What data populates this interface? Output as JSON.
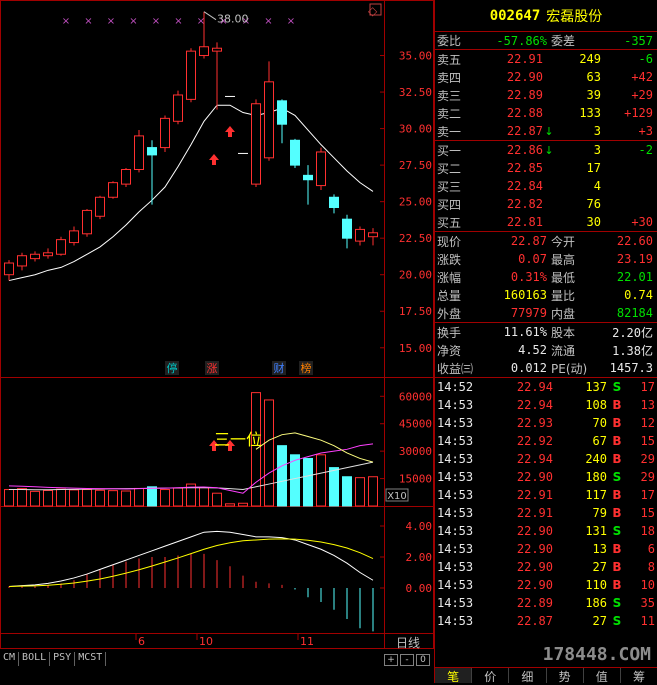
{
  "header": {
    "code": "002647",
    "name": "宏磊股份"
  },
  "ratio": {
    "weibi_label": "委比",
    "weibi_value": "-57.86%",
    "weicha_label": "委差",
    "weicha_value": "-357"
  },
  "asks": [
    {
      "label": "卖五",
      "price": "22.91",
      "vol": "249",
      "chg": "-6",
      "chg_color": "green",
      "arrow": ""
    },
    {
      "label": "卖四",
      "price": "22.90",
      "vol": "63",
      "chg": "+42",
      "chg_color": "red",
      "arrow": ""
    },
    {
      "label": "卖三",
      "price": "22.89",
      "vol": "39",
      "chg": "+29",
      "chg_color": "red",
      "arrow": ""
    },
    {
      "label": "卖二",
      "price": "22.88",
      "vol": "133",
      "chg": "+129",
      "chg_color": "red",
      "arrow": ""
    },
    {
      "label": "卖一",
      "price": "22.87",
      "vol": "3",
      "chg": "+3",
      "chg_color": "red",
      "arrow": "↓"
    }
  ],
  "bids": [
    {
      "label": "买一",
      "price": "22.86",
      "vol": "3",
      "chg": "-2",
      "chg_color": "green",
      "arrow": "↓"
    },
    {
      "label": "买二",
      "price": "22.85",
      "vol": "17",
      "chg": "",
      "chg_color": "red",
      "arrow": ""
    },
    {
      "label": "买三",
      "price": "22.84",
      "vol": "4",
      "chg": "",
      "chg_color": "red",
      "arrow": ""
    },
    {
      "label": "买四",
      "price": "22.82",
      "vol": "76",
      "chg": "",
      "chg_color": "red",
      "arrow": ""
    },
    {
      "label": "买五",
      "price": "22.81",
      "vol": "30",
      "chg": "+30",
      "chg_color": "red",
      "arrow": ""
    }
  ],
  "quote1": [
    {
      "l1": "现价",
      "v1": "22.87",
      "v1c": "red",
      "l2": "今开",
      "v2": "22.60",
      "v2c": "red"
    },
    {
      "l1": "涨跌",
      "v1": "0.07",
      "v1c": "red",
      "l2": "最高",
      "v2": "23.19",
      "v2c": "red"
    },
    {
      "l1": "涨幅",
      "v1": "0.31%",
      "v1c": "red",
      "l2": "最低",
      "v2": "22.01",
      "v2c": "green"
    },
    {
      "l1": "总量",
      "v1": "160163",
      "v1c": "yellow",
      "l2": "量比",
      "v2": "0.74",
      "v2c": "yellow"
    },
    {
      "l1": "外盘",
      "v1": "77979",
      "v1c": "red",
      "l2": "内盘",
      "v2": "82184",
      "v2c": "green"
    }
  ],
  "quote2": [
    {
      "l1": "换手",
      "v1": "11.61%",
      "v1c": "white",
      "l2": "股本",
      "v2": "2.20亿",
      "v2c": "white"
    },
    {
      "l1": "净资",
      "v1": "4.52",
      "v1c": "white",
      "l2": "流通",
      "v2": "1.38亿",
      "v2c": "white"
    },
    {
      "l1": "收益㈢",
      "v1": "0.012",
      "v1c": "white",
      "l2": "PE(动)",
      "v2": "1457.3",
      "v2c": "white"
    }
  ],
  "ticks": [
    {
      "time": "14:52",
      "price": "22.94",
      "vol": "137",
      "bs": "S",
      "n": "17"
    },
    {
      "time": "14:53",
      "price": "22.94",
      "vol": "108",
      "bs": "B",
      "n": "13"
    },
    {
      "time": "14:53",
      "price": "22.93",
      "vol": "70",
      "bs": "B",
      "n": "12"
    },
    {
      "time": "14:53",
      "price": "22.92",
      "vol": "67",
      "bs": "B",
      "n": "15"
    },
    {
      "time": "14:53",
      "price": "22.94",
      "vol": "240",
      "bs": "B",
      "n": "29"
    },
    {
      "time": "14:53",
      "price": "22.90",
      "vol": "180",
      "bs": "S",
      "n": "29"
    },
    {
      "time": "14:53",
      "price": "22.91",
      "vol": "117",
      "bs": "B",
      "n": "17"
    },
    {
      "time": "14:53",
      "price": "22.91",
      "vol": "79",
      "bs": "B",
      "n": "15"
    },
    {
      "time": "14:53",
      "price": "22.90",
      "vol": "131",
      "bs": "S",
      "n": "18"
    },
    {
      "time": "14:53",
      "price": "22.90",
      "vol": "13",
      "bs": "B",
      "n": "6"
    },
    {
      "time": "14:53",
      "price": "22.90",
      "vol": "27",
      "bs": "B",
      "n": "8"
    },
    {
      "time": "14:53",
      "price": "22.90",
      "vol": "110",
      "bs": "B",
      "n": "10"
    },
    {
      "time": "14:53",
      "price": "22.89",
      "vol": "186",
      "bs": "S",
      "n": "35"
    },
    {
      "time": "14:53",
      "price": "22.87",
      "vol": "27",
      "bs": "S",
      "n": "11"
    }
  ],
  "bottom_tabs": [
    "笔",
    "价",
    "细",
    "势",
    "值",
    "筹"
  ],
  "watermark": "178448.COM",
  "indicator_tabs": [
    "CM",
    "BOLL",
    "PSY",
    "MCST"
  ],
  "period_label": "日线",
  "nav_buttons": [
    "+",
    "-",
    "0"
  ],
  "chart_data": {
    "type": "candlestick",
    "price_axis": [
      "35.00",
      "32.50",
      "30.00",
      "27.50",
      "25.00",
      "22.50",
      "20.00",
      "17.50",
      "15.00"
    ],
    "high_label": "38.00",
    "volume_axis": [
      "60000",
      "45000",
      "30000",
      "15000"
    ],
    "volume_unit": "X10",
    "macd_axis": [
      "4.00",
      "2.00",
      "0.00"
    ],
    "x_ticks": [
      "6",
      "10",
      "11"
    ],
    "event_markers": [
      "停",
      "涨",
      "财",
      "榜"
    ],
    "annotation": "三一位",
    "ylim": [
      13,
      38.8
    ],
    "candles": [
      {
        "o": 20.0,
        "c": 20.8,
        "h": 21.0,
        "l": 19.6
      },
      {
        "o": 20.6,
        "c": 21.3,
        "h": 21.5,
        "l": 20.3
      },
      {
        "o": 21.1,
        "c": 21.4,
        "h": 21.6,
        "l": 20.9
      },
      {
        "o": 21.3,
        "c": 21.5,
        "h": 21.8,
        "l": 21.1
      },
      {
        "o": 21.4,
        "c": 22.4,
        "h": 22.6,
        "l": 21.3
      },
      {
        "o": 22.2,
        "c": 23.0,
        "h": 23.3,
        "l": 22.0
      },
      {
        "o": 22.8,
        "c": 24.4,
        "h": 24.5,
        "l": 22.6
      },
      {
        "o": 24.0,
        "c": 25.3,
        "h": 25.4,
        "l": 23.8
      },
      {
        "o": 25.3,
        "c": 26.3,
        "h": 26.4,
        "l": 25.2
      },
      {
        "o": 26.2,
        "c": 27.2,
        "h": 27.3,
        "l": 26.0
      },
      {
        "o": 27.2,
        "c": 29.5,
        "h": 29.9,
        "l": 27.0
      },
      {
        "o": 28.7,
        "c": 28.2,
        "h": 29.2,
        "l": 24.8
      },
      {
        "o": 28.7,
        "c": 30.7,
        "h": 30.9,
        "l": 28.4
      },
      {
        "o": 30.5,
        "c": 32.3,
        "h": 32.6,
        "l": 30.3
      },
      {
        "o": 32.0,
        "c": 35.3,
        "h": 35.5,
        "l": 31.8
      },
      {
        "o": 35.0,
        "c": 35.6,
        "h": 38.0,
        "l": 34.8
      },
      {
        "o": 35.3,
        "c": 35.5,
        "h": 35.9,
        "l": 31.3
      },
      {
        "o": 32.2,
        "c": 32.2,
        "h": 32.2,
        "l": 32.2
      },
      {
        "o": 28.3,
        "c": 28.3,
        "h": 28.3,
        "l": 28.3
      },
      {
        "o": 26.2,
        "c": 31.7,
        "h": 32.0,
        "l": 26.0
      },
      {
        "o": 28.0,
        "c": 33.2,
        "h": 34.6,
        "l": 27.8
      },
      {
        "o": 31.9,
        "c": 30.3,
        "h": 32.0,
        "l": 29.0
      },
      {
        "o": 29.2,
        "c": 27.5,
        "h": 29.3,
        "l": 27.3
      },
      {
        "o": 26.8,
        "c": 26.5,
        "h": 27.5,
        "l": 24.8
      },
      {
        "o": 26.1,
        "c": 28.4,
        "h": 28.7,
        "l": 25.8
      },
      {
        "o": 25.3,
        "c": 24.6,
        "h": 25.5,
        "l": 24.2
      },
      {
        "o": 23.8,
        "c": 22.5,
        "h": 24.1,
        "l": 21.8
      },
      {
        "o": 22.3,
        "c": 23.1,
        "h": 23.3,
        "l": 22.0
      },
      {
        "o": 22.6,
        "c": 22.87,
        "h": 23.19,
        "l": 22.01
      }
    ],
    "ma": [
      19.6,
      19.8,
      20.0,
      20.3,
      20.5,
      20.9,
      21.4,
      21.9,
      22.6,
      23.4,
      24.3,
      25.1,
      26.0,
      27.4,
      28.9,
      30.5,
      31.6,
      31.6,
      31.1,
      30.9,
      31.1,
      31.4,
      30.9,
      29.9,
      28.9,
      28.0,
      27.1,
      26.3,
      25.7
    ],
    "volumes": [
      9000,
      9500,
      8000,
      8500,
      9200,
      8800,
      9000,
      8600,
      8400,
      8200,
      9600,
      10500,
      9000,
      9800,
      12000,
      10000,
      7000,
      1200,
      1500,
      62000,
      58000,
      33000,
      28000,
      26000,
      28000,
      21000,
      16000,
      15500,
      16000
    ],
    "vol_ma_a": [
      11000,
      10800,
      10500,
      10200,
      10000,
      9800,
      9600,
      9500,
      9400,
      9300,
      9500,
      9700,
      9800,
      10000,
      10300,
      10400,
      10000,
      8500,
      7000,
      13000,
      18000,
      22000,
      25000,
      27000,
      29000,
      30000,
      31000,
      33000,
      34000
    ],
    "vol_ma_b": [
      9000,
      9000,
      8900,
      8900,
      9000,
      9100,
      9200,
      9300,
      9400,
      9500,
      9600,
      9700,
      9800,
      9900,
      10000,
      10000,
      9900,
      9500,
      9000,
      10500,
      12000,
      13500,
      15000,
      16500,
      18000,
      19500,
      21000,
      22500,
      24000
    ],
    "vol_line": [
      null,
      null,
      null,
      null,
      null,
      null,
      null,
      null,
      null,
      null,
      null,
      null,
      null,
      null,
      null,
      null,
      null,
      null,
      null,
      31000,
      36000,
      39000,
      40000,
      38000,
      36000,
      33000,
      29000,
      26000,
      24000
    ],
    "dif": [
      0.1,
      0.15,
      0.2,
      0.3,
      0.45,
      0.65,
      0.9,
      1.2,
      1.5,
      1.8,
      2.1,
      2.4,
      2.7,
      3.0,
      3.3,
      3.6,
      3.65,
      3.6,
      3.45,
      3.3,
      3.3,
      3.25,
      3.1,
      2.8,
      2.5,
      2.1,
      1.6,
      1.0,
      0.5
    ],
    "dea": [
      0.1,
      0.12,
      0.14,
      0.18,
      0.24,
      0.32,
      0.44,
      0.58,
      0.76,
      0.96,
      1.18,
      1.42,
      1.68,
      1.94,
      2.22,
      2.5,
      2.74,
      2.92,
      3.05,
      3.1,
      3.15,
      3.17,
      3.15,
      3.08,
      2.97,
      2.8,
      2.58,
      2.28,
      1.9
    ],
    "macd": [
      0.1,
      0.1,
      0.1,
      0.2,
      0.3,
      0.5,
      0.9,
      1.2,
      1.5,
      1.7,
      1.9,
      2.0,
      2.0,
      2.1,
      2.2,
      2.2,
      1.8,
      1.4,
      0.8,
      0.4,
      0.3,
      0.2,
      -0.1,
      -0.6,
      -0.9,
      -1.4,
      -2.0,
      -2.6,
      -2.8
    ]
  }
}
